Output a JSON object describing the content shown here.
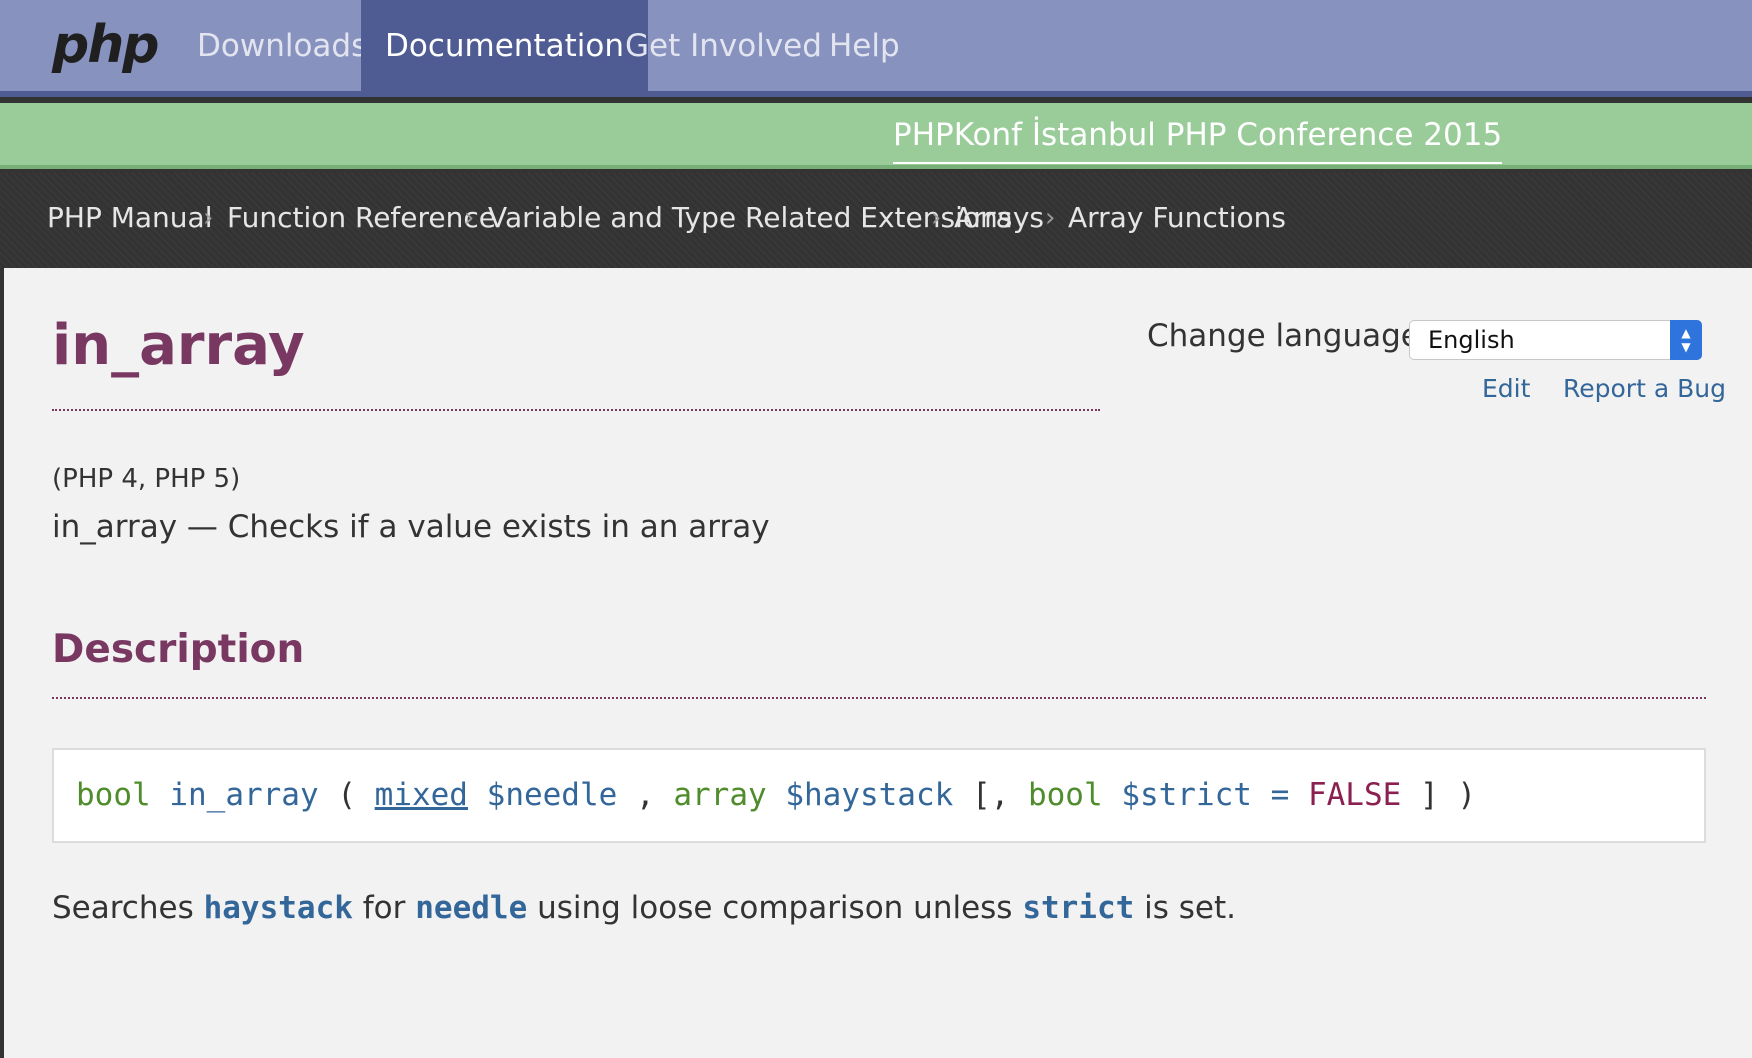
{
  "navbar": {
    "logo": "php",
    "items": [
      {
        "label": "Downloads",
        "active": false
      },
      {
        "label": "Documentation",
        "active": true
      },
      {
        "label": "Get Involved",
        "active": false
      },
      {
        "label": "Help",
        "active": false
      }
    ]
  },
  "banner": {
    "text": "PHPKonf İstanbul PHP Conference 2015"
  },
  "breadcrumb": {
    "items": [
      "PHP Manual",
      "Function Reference",
      "Variable and Type Related Extensions",
      "Arrays",
      "Array Functions"
    ],
    "separator": "›"
  },
  "page": {
    "title": "in_array",
    "versions": "(PHP 4, PHP 5)",
    "refpurpose": "in_array — Checks if a value exists in an array"
  },
  "language": {
    "label": "Change language:",
    "selected": "English"
  },
  "links": {
    "edit": "Edit",
    "report_bug": "Report a Bug"
  },
  "description": {
    "heading": "Description",
    "synopsis": {
      "return_type": "bool",
      "function": "in_array",
      "open_paren": "(",
      "p1_type": "mixed",
      "p1_name": "$needle",
      "comma1": ",",
      "p2_type": "array",
      "p2_name": "$haystack",
      "optional_open": "[,",
      "p3_type": "bool",
      "p3_name": "$strict",
      "equals": "=",
      "p3_default": "FALSE",
      "optional_close": "]",
      "close_paren": ")"
    },
    "text": {
      "part1": "Searches",
      "haystack": "haystack",
      "part2": "for",
      "needle": "needle",
      "part3": "using loose comparison unless",
      "strict": "strict",
      "part4": "is set."
    }
  },
  "colors": {
    "nav_bg": "#8892bf",
    "nav_active_bg": "#4f5b93",
    "banner_bg": "#99cc99",
    "breadcrumb_bg": "#333333",
    "content_bg": "#f2f2f2",
    "title": "#793862",
    "link": "#336699"
  }
}
